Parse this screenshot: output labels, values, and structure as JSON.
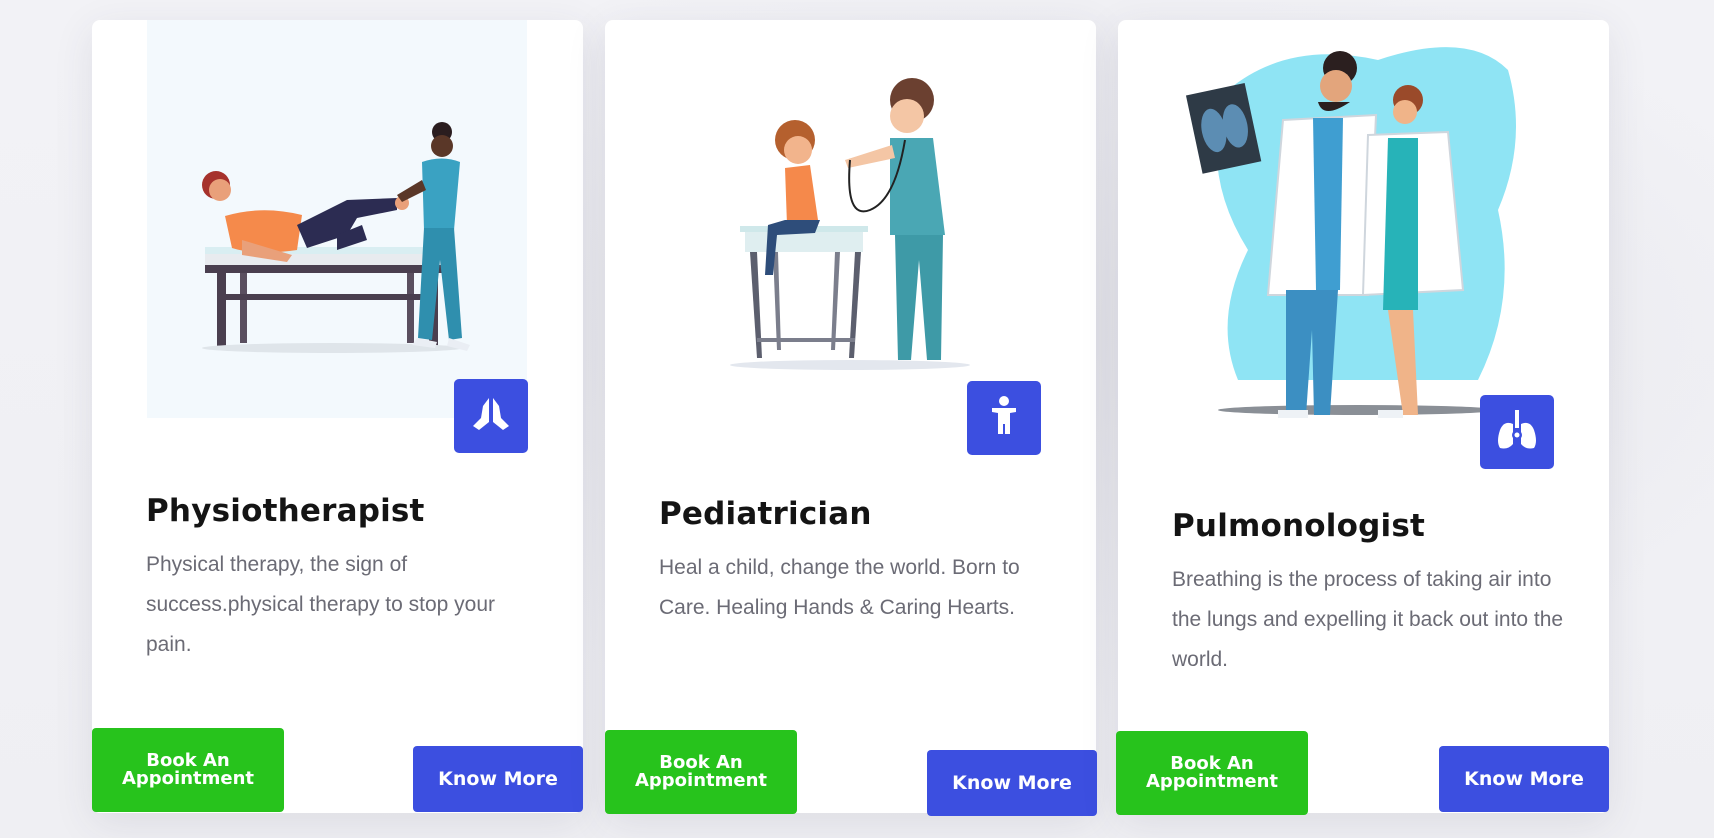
{
  "cards": [
    {
      "title": "Physiotherapist",
      "description": "Physical therapy, the sign of success.physical therapy to stop your pain.",
      "badge_icon": "praying-hands-icon",
      "book_label": "Book An Appointment",
      "more_label": "Know More"
    },
    {
      "title": "Pediatrician",
      "description": "Heal a child, change the world. Born to Care. Healing Hands & Caring Hearts.",
      "badge_icon": "child-icon",
      "book_label": "Book An Appointment",
      "more_label": "Know More"
    },
    {
      "title": "Pulmonologist",
      "description": "Breathing is the process of taking air into the lungs and expelling it back out into the world.",
      "badge_icon": "lungs-icon",
      "book_label": "Book An Appointment",
      "more_label": "Know More"
    }
  ],
  "colors": {
    "accent_blue": "#3c4fe0",
    "book_green": "#27c31c",
    "title_text": "#141414",
    "body_text": "#6b6b75"
  }
}
